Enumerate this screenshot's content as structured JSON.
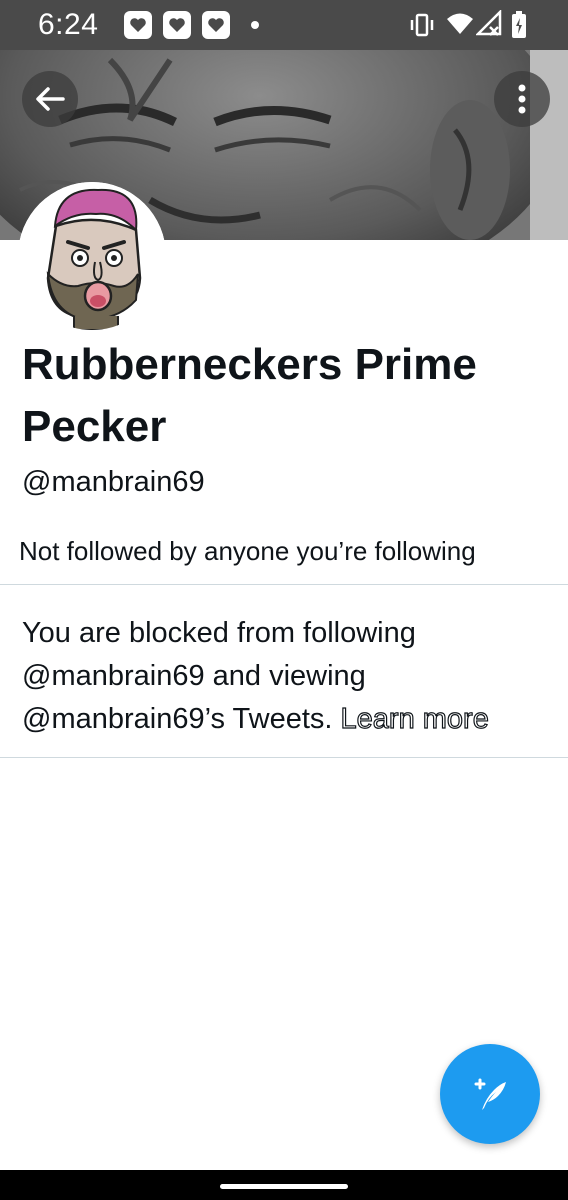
{
  "status_bar": {
    "time": "6:24",
    "icons": [
      "notification-icon",
      "notification-icon",
      "notification-icon",
      "dot-icon",
      "vibrate-icon",
      "wifi-icon",
      "signal-icon",
      "battery-icon"
    ]
  },
  "header": {
    "back_icon": "back-arrow-icon",
    "more_icon": "more-vertical-icon"
  },
  "profile": {
    "display_name": "Rubberneckers Prime Pecker",
    "handle": "@manbrain69",
    "followed_by": "Not followed by anyone you’re following"
  },
  "blocked": {
    "message": "You are blocked from following @manbrain69 and viewing @manbrain69’s Tweets.",
    "learn_more": "Learn more"
  },
  "fab": {
    "icon": "compose-tweet-icon"
  },
  "colors": {
    "accent": "#1d9bf0",
    "status_bar": "#4a4a4a",
    "text": "#0f1419",
    "divider": "#cfd9de"
  }
}
